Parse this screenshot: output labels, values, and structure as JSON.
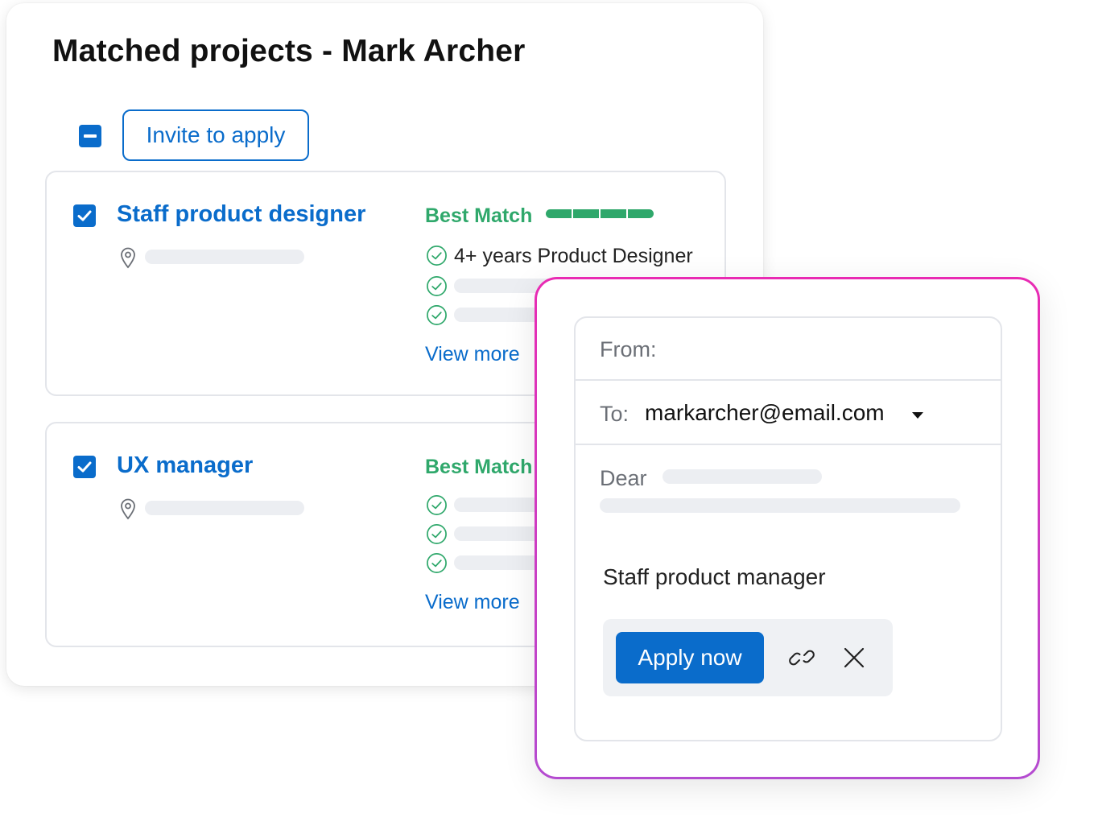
{
  "page": {
    "title": "Matched projects - Mark Archer"
  },
  "toolbar": {
    "invite_label": "Invite to apply"
  },
  "projects": [
    {
      "title": "Staff product designer",
      "match_label": "Best Match",
      "match_level": 1.0,
      "criteria": [
        "4+ years Product Designer",
        "",
        ""
      ],
      "view_more": "View more"
    },
    {
      "title": "UX manager",
      "match_label": "Best Match",
      "criteria": [
        "",
        "",
        ""
      ],
      "view_more": "View more"
    }
  ],
  "email": {
    "from_label": "From:",
    "to_label": "To:",
    "to_value": "markarcher@email.com",
    "dear_label": "Dear",
    "role": "Staff product manager",
    "apply_label": "Apply now"
  },
  "colors": {
    "accent": "#0a6ccb",
    "match": "#2fa86b",
    "popup_border_top": "#e92bb3",
    "popup_border_bottom": "#b44bd0"
  },
  "icons": [
    "minus-checkbox-icon",
    "check-icon",
    "location-pin-icon",
    "check-circle-icon",
    "caret-down-icon",
    "link-icon",
    "close-icon"
  ]
}
